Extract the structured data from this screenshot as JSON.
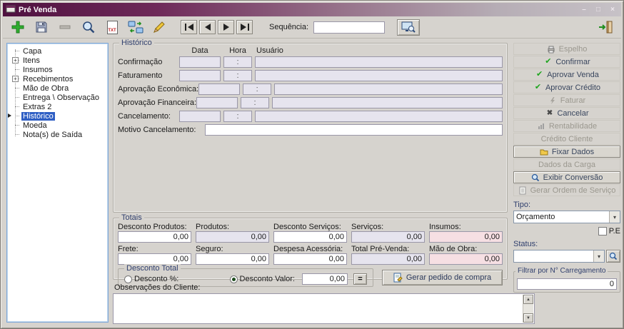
{
  "window": {
    "title": "Pré Venda",
    "controls": {
      "minimize": "–",
      "maximize": "□",
      "close": "×"
    }
  },
  "toolbar": {
    "txt_label": "TXT",
    "sequence_label": "Sequência:",
    "sequence_value": ""
  },
  "tree": {
    "expand_glyph": "+",
    "items": [
      {
        "label": "Capa",
        "expandable": false,
        "selected": false
      },
      {
        "label": "Itens",
        "expandable": true,
        "selected": false
      },
      {
        "label": "Insumos",
        "expandable": false,
        "selected": false
      },
      {
        "label": "Recebimentos",
        "expandable": true,
        "selected": false
      },
      {
        "label": "Mão de Obra",
        "expandable": false,
        "selected": false
      },
      {
        "label": "Entrega \\ Observação",
        "expandable": false,
        "selected": false
      },
      {
        "label": "Extras 2",
        "expandable": false,
        "selected": false
      },
      {
        "label": "Histórico",
        "expandable": false,
        "selected": true
      },
      {
        "label": "Moeda",
        "expandable": false,
        "selected": false
      },
      {
        "label": "Nota(s) de Saída",
        "expandable": false,
        "selected": false
      }
    ]
  },
  "historico": {
    "title": "Histórico",
    "columns": {
      "data": "Data",
      "hora": "Hora",
      "usuario": "Usuário"
    },
    "hora_mask": ":",
    "rows": [
      {
        "label": "Confirmação"
      },
      {
        "label": "Faturamento"
      },
      {
        "label": "Aprovação Econômica:"
      },
      {
        "label": "Aprovação Financeira:"
      },
      {
        "label": "Cancelamento:"
      }
    ],
    "motivo_label": "Motivo Cancelamento:",
    "motivo_value": ""
  },
  "totais": {
    "title": "Totais",
    "fields_row1": [
      {
        "label": "Desconto Produtos:",
        "value": "0,00"
      },
      {
        "label": "Produtos:",
        "value": "0,00"
      },
      {
        "label": "Desconto Serviços:",
        "value": "0,00"
      },
      {
        "label": "Serviços:",
        "value": "0,00"
      },
      {
        "label": "Insumos:",
        "value": "0,00"
      }
    ],
    "fields_row2": [
      {
        "label": "Frete:",
        "value": "0,00"
      },
      {
        "label": "Seguro:",
        "value": "0,00"
      },
      {
        "label": "Despesa Acessória:",
        "value": "0,00"
      },
      {
        "label": "Total Pré-Venda:",
        "value": "0,00"
      },
      {
        "label": "Mão de Obra:",
        "value": "0,00"
      }
    ],
    "desconto": {
      "title": "Desconto Total",
      "percent_label": "Desconto %:",
      "valor_label": "Desconto Valor:",
      "valor_value": "0,00",
      "equals_label": "="
    },
    "gerar_pedido_label": "Gerar pedido de compra"
  },
  "observacoes": {
    "label": "Observações do Cliente:",
    "value": ""
  },
  "right_panel": {
    "buttons": [
      {
        "label": "Espelho",
        "icon": "printer-icon",
        "enabled": false
      },
      {
        "label": "Confirmar",
        "icon": "check-icon",
        "enabled": true
      },
      {
        "label": "Aprovar Venda",
        "icon": "check-icon",
        "enabled": true
      },
      {
        "label": "Aprovar Crédito",
        "icon": "check-icon",
        "enabled": true
      },
      {
        "label": "Faturar",
        "icon": "lightning-icon",
        "enabled": false
      },
      {
        "label": "Cancelar",
        "icon": "x-icon",
        "enabled": true
      },
      {
        "label": "Rentabilidade",
        "icon": "chart-icon",
        "enabled": false
      },
      {
        "label": "Crédito Cliente",
        "icon": "",
        "enabled": false
      },
      {
        "label": "Fixar Dados",
        "icon": "folder-icon",
        "enabled": true
      },
      {
        "label": "Dados da Carga",
        "icon": "",
        "enabled": false
      },
      {
        "label": "Exibir Conversão",
        "icon": "magnifier-icon",
        "enabled": true
      },
      {
        "label": "Gerar Ordem de Serviço",
        "icon": "document-icon",
        "enabled": false
      }
    ],
    "tipo_label": "Tipo:",
    "tipo_value": "Orçamento",
    "pe_label": "P.E",
    "status_label": "Status:",
    "status_value": "",
    "filtrar_label": "Filtrar por N° Carregamento",
    "filtrar_value": "0"
  },
  "colors": {
    "titlebar_accent": "#4f1140",
    "selection": "#2f5fc4",
    "readonly_field": "#e6e4ee",
    "pink_field": "#f6dfe3",
    "check_green": "#1ea51e"
  }
}
